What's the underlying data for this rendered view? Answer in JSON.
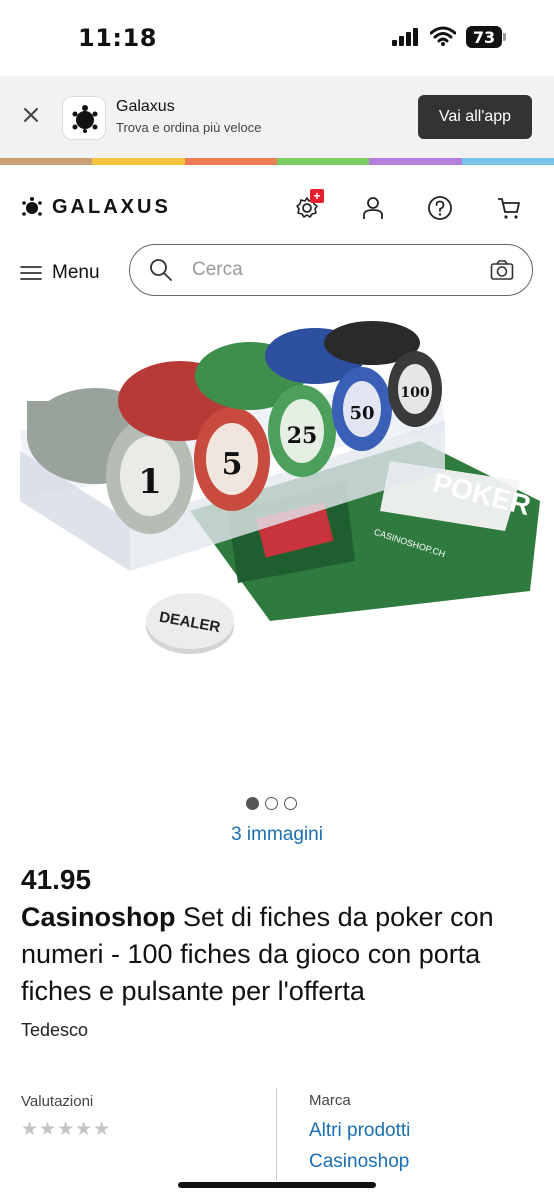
{
  "status_bar": {
    "time": "11:18",
    "battery": "73"
  },
  "app_banner": {
    "app_name": "Galaxus",
    "subtitle": "Trova e ordina più veloce",
    "open_button": "Vai all'app"
  },
  "rainbow_colors": [
    "#c8a274",
    "#f6c43c",
    "#ef7d57",
    "#7dcd63",
    "#b47fdc",
    "#7cc4ec"
  ],
  "header": {
    "logo": "GALAXUS",
    "settings_badge": "+",
    "menu_label": "Menu",
    "search_placeholder": "Cerca"
  },
  "product_image": {
    "dealer_button_text": "DEALER",
    "card_title": "POKER",
    "card_site": "CASINOSHOP.CH",
    "chip_values": [
      "1",
      "5",
      "25",
      "50",
      "100"
    ]
  },
  "gallery": {
    "image_count_label": "3 immagini",
    "dots": 3,
    "active_dot": 1
  },
  "product": {
    "price": "41.95",
    "brand": "Casinoshop",
    "title": " Set di fiches da poker con numeri - 100 fiches da gioco con porta fiches e pulsante per l'offerta",
    "language": "Tedesco"
  },
  "ratings": {
    "label": "Valutazioni",
    "stars": "★★★★★"
  },
  "brand_section": {
    "label": "Marca",
    "link_line1": "Altri prodotti",
    "link_line2": "Casinoshop"
  },
  "colors": {
    "link": "#1a6fb3",
    "button_dark": "#333333",
    "badge_red": "#e4202c"
  }
}
